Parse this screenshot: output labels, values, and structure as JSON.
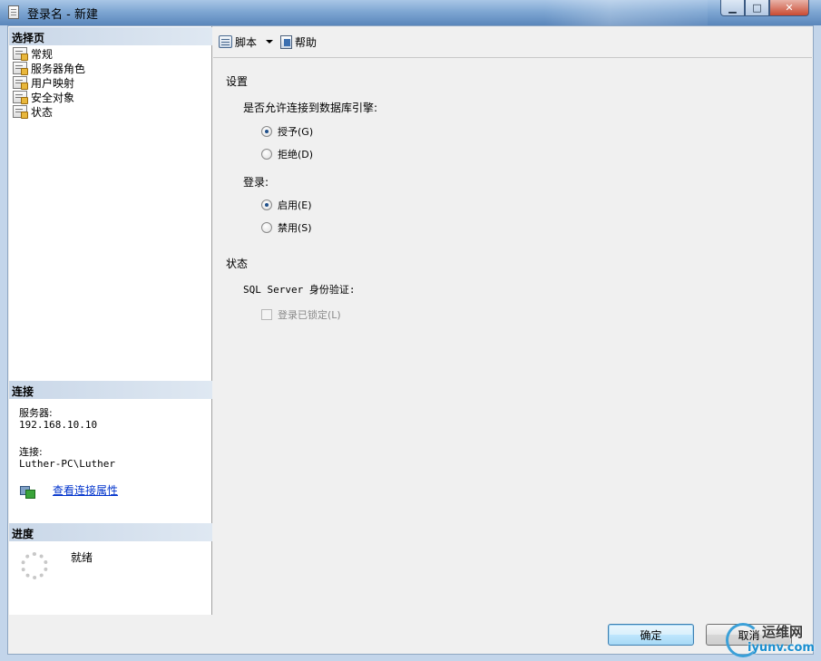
{
  "window": {
    "title": "登录名 - 新建",
    "caption_buttons": {
      "minimize": "▁",
      "maximize": "□",
      "close": "✕"
    }
  },
  "sidebar": {
    "pages_header": "选择页",
    "items": [
      {
        "label": "常规"
      },
      {
        "label": "服务器角色"
      },
      {
        "label": "用户映射"
      },
      {
        "label": "安全对象"
      },
      {
        "label": "状态"
      }
    ],
    "connection": {
      "header": "连接",
      "server_label": "服务器:",
      "server_value": "192.168.10.10",
      "connection_label": "连接:",
      "connection_value": "Luther-PC\\Luther",
      "link": "查看连接属性"
    },
    "progress": {
      "header": "进度",
      "status": "就绪"
    }
  },
  "toolbar": {
    "script_label": "脚本",
    "help_label": "帮助"
  },
  "settings": {
    "section_title": "设置",
    "permission_question": "是否允许连接到数据库引擎:",
    "grant_label": "授予(G)",
    "deny_label": "拒绝(D)",
    "grant_selected": true,
    "login_label": "登录:",
    "enable_label": "启用(E)",
    "disable_label": "禁用(S)",
    "enable_selected": true
  },
  "status": {
    "section_title": "状态",
    "auth_label": "SQL Server 身份验证:",
    "locked_label": "登录已锁定(L)",
    "locked_checked": false
  },
  "buttons": {
    "ok": "确定",
    "cancel": "取消"
  },
  "watermark": {
    "title": "运维网",
    "url": "iyunv.com"
  },
  "colors": {
    "title_bar": "#7fa7d3",
    "section_header": "#c9d7e8",
    "link": "#0033cc",
    "dialog_bg": "#f0f0f0"
  }
}
